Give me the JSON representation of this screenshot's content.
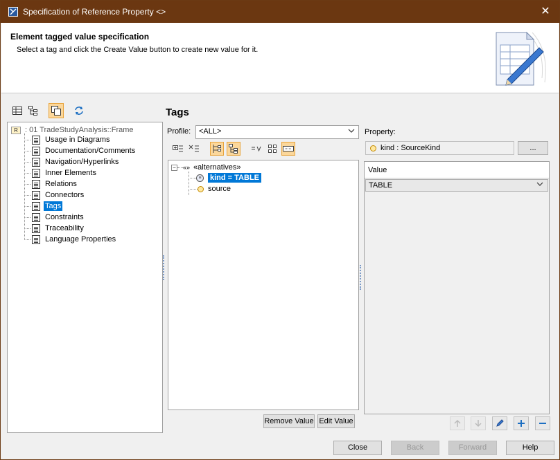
{
  "window": {
    "title": "Specification of Reference Property <>",
    "close_glyph": "✕"
  },
  "header": {
    "title": "Element tagged value specification",
    "subtitle": "Select a tag and click the Create Value button to create new value for it."
  },
  "left_tree": {
    "root_icon_text": "R",
    "root_label": ": 01 TradeStudyAnalysis::Frame",
    "items": [
      {
        "label": "Usage in Diagrams"
      },
      {
        "label": "Documentation/Comments"
      },
      {
        "label": "Navigation/Hyperlinks"
      },
      {
        "label": "Inner Elements"
      },
      {
        "label": "Relations"
      },
      {
        "label": "Connectors"
      },
      {
        "label": "Tags"
      },
      {
        "label": "Constraints"
      },
      {
        "label": "Traceability"
      },
      {
        "label": "Language Properties"
      }
    ],
    "selected": "Tags"
  },
  "tags_panel": {
    "title": "Tags",
    "profile_label": "Profile:",
    "profile_value": "<ALL>",
    "tree": {
      "root_label": "«alternatives»",
      "root_prefix": "«»",
      "items": [
        {
          "label": "kind = TABLE",
          "selected": true
        },
        {
          "label": "source",
          "selected": false
        }
      ]
    },
    "remove_value": "Remove Value",
    "edit_value": "Edit Value"
  },
  "property_panel": {
    "property_label": "Property:",
    "property_value": "kind : SourceKind",
    "browse_button": "...",
    "value_header": "Value",
    "value": "TABLE"
  },
  "footer": {
    "close": "Close",
    "back": "Back",
    "forward": "Forward",
    "help": "Help"
  },
  "colors": {
    "titlebar": "#6b3711",
    "selection": "#0078d7",
    "active_toggle": "#fbd79b"
  }
}
